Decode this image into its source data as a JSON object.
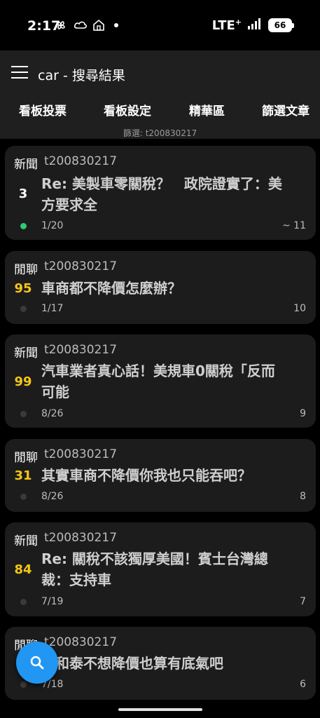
{
  "status_bar": {
    "time": "2:17",
    "network": "LTE",
    "network_plus": "+",
    "battery": "66",
    "icons": [
      "pinwheel-icon",
      "cloud-icon",
      "home-icon",
      "notification-dot"
    ]
  },
  "app_bar": {
    "title": "car - 搜尋結果",
    "menu_icon": "hamburger-menu-icon"
  },
  "tabs": [
    "看板投票",
    "看板設定",
    "精華區",
    "篩選文章"
  ],
  "filter_label": "篩選: t200830217",
  "colors": {
    "background": "#000000",
    "card": "#1c1c1c",
    "score_white": "#ffffff",
    "score_yellow": "#f5c518",
    "online_dot": "#2ecc71",
    "fab": "#2196f3"
  },
  "posts": [
    {
      "category": "新聞",
      "author": "t200830217",
      "score": "3",
      "score_color": "#ffffff",
      "title_line1": "Re: 美製車零關稅？　政院證實了：美",
      "title_line2": "方要求全",
      "date": "1/20",
      "count": "~ 11",
      "dot": "online"
    },
    {
      "category": "閒聊",
      "author": "t200830217",
      "score": "95",
      "score_color": "#f5c518",
      "title_line1": "車商都不降價怎麼辦？",
      "title_line2": "",
      "date": "1/17",
      "count": "10",
      "dot": "offline"
    },
    {
      "category": "新聞",
      "author": "t200830217",
      "score": "99",
      "score_color": "#f5c518",
      "title_line1": "汽車業者真心話！美規車0關稅「反而",
      "title_line2": "可能",
      "date": "8/26",
      "count": "9",
      "dot": "offline"
    },
    {
      "category": "閒聊",
      "author": "t200830217",
      "score": "31",
      "score_color": "#f5c518",
      "title_line1": "其實車商不降價你我也只能吞吧？",
      "title_line2": "",
      "date": "8/26",
      "count": "8",
      "dot": "offline"
    },
    {
      "category": "新聞",
      "author": "t200830217",
      "score": "84",
      "score_color": "#f5c518",
      "title_line1": "Re: 關稅不該獨厚美國！賓士台灣總",
      "title_line2": "裁：支持車",
      "date": "7/19",
      "count": "7",
      "dot": "offline"
    },
    {
      "category": "閒聊",
      "author": "t200830217",
      "score": "",
      "score_color": "#f5c518",
      "title_line1": "果和泰不想降價也算有底氣吧",
      "title_line2": "",
      "date": "7/18",
      "count": "6",
      "dot": "offline"
    }
  ],
  "fab": {
    "icon": "search-icon"
  }
}
